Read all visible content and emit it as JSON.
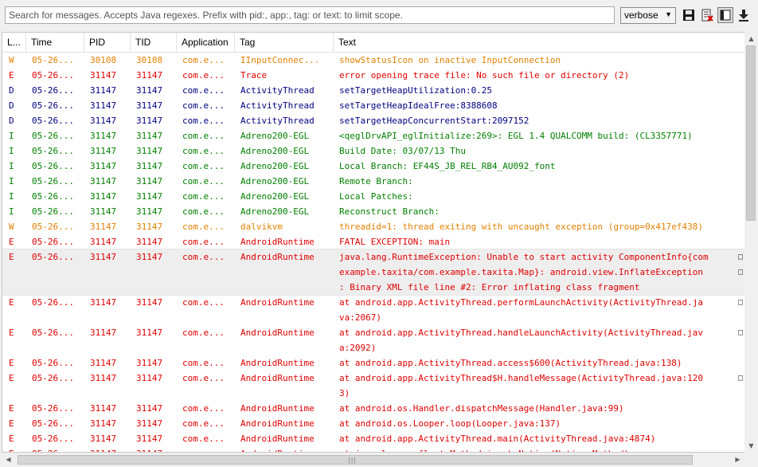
{
  "toolbar": {
    "search_placeholder": "Search for messages. Accepts Java regexes. Prefix with pid:, app:, tag: or text: to limit scope.",
    "level_selected": "verbose"
  },
  "columns": [
    "L...",
    "Time",
    "PID",
    "TID",
    "Application",
    "Tag",
    "Text"
  ],
  "colors": {
    "W": "#e28000",
    "E": "#e00000",
    "D": "#00007f",
    "I": "#007f00"
  },
  "rows": [
    {
      "level": "W",
      "time": "05-26...",
      "pid": "30108",
      "tid": "30108",
      "app": "com.e...",
      "tag": "IInputConnec...",
      "text": "showStatusIcon on inactive InputConnection"
    },
    {
      "level": "E",
      "time": "05-26...",
      "pid": "31147",
      "tid": "31147",
      "app": "com.e...",
      "tag": "Trace",
      "text": "error opening trace file: No such file or directory (2)"
    },
    {
      "level": "D",
      "time": "05-26...",
      "pid": "31147",
      "tid": "31147",
      "app": "com.e...",
      "tag": "ActivityThread",
      "text": "setTargetHeapUtilization:0.25"
    },
    {
      "level": "D",
      "time": "05-26...",
      "pid": "31147",
      "tid": "31147",
      "app": "com.e...",
      "tag": "ActivityThread",
      "text": "setTargetHeapIdealFree:8388608"
    },
    {
      "level": "D",
      "time": "05-26...",
      "pid": "31147",
      "tid": "31147",
      "app": "com.e...",
      "tag": "ActivityThread",
      "text": "setTargetHeapConcurrentStart:2097152"
    },
    {
      "level": "I",
      "time": "05-26...",
      "pid": "31147",
      "tid": "31147",
      "app": "com.e...",
      "tag": "Adreno200-EGL",
      "text": "<qeglDrvAPI_eglInitialize:269>: EGL 1.4 QUALCOMM build:  (CL3357771)"
    },
    {
      "level": "I",
      "time": "05-26...",
      "pid": "31147",
      "tid": "31147",
      "app": "com.e...",
      "tag": "Adreno200-EGL",
      "text": "Build Date: 03/07/13 Thu"
    },
    {
      "level": "I",
      "time": "05-26...",
      "pid": "31147",
      "tid": "31147",
      "app": "com.e...",
      "tag": "Adreno200-EGL",
      "text": "Local Branch: EF44S_JB_REL_RB4_AU092_font"
    },
    {
      "level": "I",
      "time": "05-26...",
      "pid": "31147",
      "tid": "31147",
      "app": "com.e...",
      "tag": "Adreno200-EGL",
      "text": "Remote Branch:"
    },
    {
      "level": "I",
      "time": "05-26...",
      "pid": "31147",
      "tid": "31147",
      "app": "com.e...",
      "tag": "Adreno200-EGL",
      "text": "Local Patches:"
    },
    {
      "level": "I",
      "time": "05-26...",
      "pid": "31147",
      "tid": "31147",
      "app": "com.e...",
      "tag": "Adreno200-EGL",
      "text": "Reconstruct Branch:"
    },
    {
      "level": "W",
      "time": "05-26...",
      "pid": "31147",
      "tid": "31147",
      "app": "com.e...",
      "tag": "dalvikvm",
      "text": "threadid=1: thread exiting with uncaught exception (group=0x417ef438)"
    },
    {
      "level": "E",
      "time": "05-26...",
      "pid": "31147",
      "tid": "31147",
      "app": "com.e...",
      "tag": "AndroidRuntime",
      "text": "FATAL EXCEPTION: main"
    },
    {
      "level": "E",
      "time": "05-26...",
      "pid": "31147",
      "tid": "31147",
      "app": "com.e...",
      "tag": "AndroidRuntime",
      "selected": true,
      "lines": [
        "java.lang.RuntimeException: Unable to start activity ComponentInfo{com",
        "example.taxita/com.example.taxita.Map}: android.view.InflateException",
        ": Binary XML file line #2: Error inflating class fragment"
      ]
    },
    {
      "level": "E",
      "time": "05-26...",
      "pid": "31147",
      "tid": "31147",
      "app": "com.e...",
      "tag": "AndroidRuntime",
      "lines": [
        "at android.app.ActivityThread.performLaunchActivity(ActivityThread.ja",
        "va:2067)"
      ]
    },
    {
      "level": "E",
      "time": "05-26...",
      "pid": "31147",
      "tid": "31147",
      "app": "com.e...",
      "tag": "AndroidRuntime",
      "lines": [
        "at android.app.ActivityThread.handleLaunchActivity(ActivityThread.jav",
        "a:2092)"
      ]
    },
    {
      "level": "E",
      "time": "05-26...",
      "pid": "31147",
      "tid": "31147",
      "app": "com.e...",
      "tag": "AndroidRuntime",
      "text": "at android.app.ActivityThread.access$600(ActivityThread.java:138)"
    },
    {
      "level": "E",
      "time": "05-26...",
      "pid": "31147",
      "tid": "31147",
      "app": "com.e...",
      "tag": "AndroidRuntime",
      "lines": [
        "at android.app.ActivityThread$H.handleMessage(ActivityThread.java:120",
        "3)"
      ]
    },
    {
      "level": "E",
      "time": "05-26...",
      "pid": "31147",
      "tid": "31147",
      "app": "com.e...",
      "tag": "AndroidRuntime",
      "text": "at android.os.Handler.dispatchMessage(Handler.java:99)"
    },
    {
      "level": "E",
      "time": "05-26...",
      "pid": "31147",
      "tid": "31147",
      "app": "com.e...",
      "tag": "AndroidRuntime",
      "text": "at android.os.Looper.loop(Looper.java:137)"
    },
    {
      "level": "E",
      "time": "05-26...",
      "pid": "31147",
      "tid": "31147",
      "app": "com.e...",
      "tag": "AndroidRuntime",
      "text": "at android.app.ActivityThread.main(ActivityThread.java:4874)"
    },
    {
      "level": "E",
      "time": "05-26...",
      "pid": "31147",
      "tid": "31147",
      "app": "com.e...",
      "tag": "AndroidRuntime",
      "text": "at java.lang.reflect.Method.invokeNative(Native Method)"
    }
  ]
}
